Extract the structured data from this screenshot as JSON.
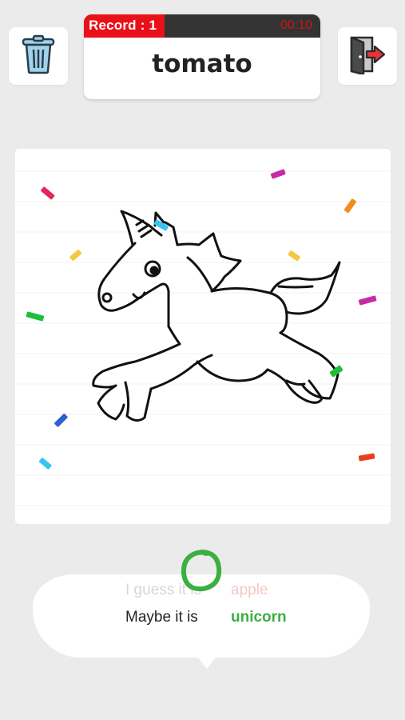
{
  "header": {
    "record_label": "Record : 1",
    "record_progress": 0.34,
    "timer": "00:10",
    "target_word": "tomato"
  },
  "buttons": {
    "trash_icon": "trash-can-icon",
    "exit_icon": "exit-door-icon"
  },
  "canvas": {
    "drawing": "unicorn sketch",
    "confetti_colors": [
      "#e8245a",
      "#c72aa6",
      "#f28a1e",
      "#f5c842",
      "#1fbe3a",
      "#2f5fd0",
      "#38c4f0",
      "#e83d1e"
    ]
  },
  "guesses": {
    "previous": {
      "prefix": "I guess it is",
      "word": "apple"
    },
    "current": {
      "prefix": "Maybe it is",
      "word": "unicorn"
    }
  },
  "colors": {
    "record_red": "#e8111a",
    "correct_green": "#3bb040"
  }
}
